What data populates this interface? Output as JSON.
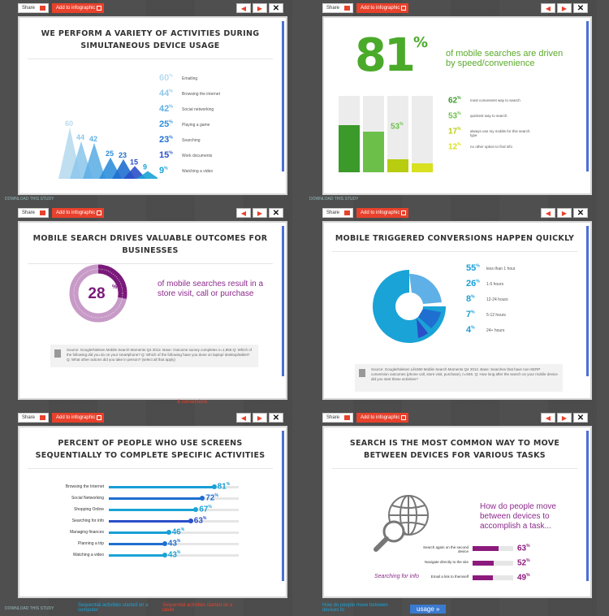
{
  "toolbar": {
    "share_label": "Share",
    "add_label": "Add to infographic",
    "prev": "◀",
    "next": "▶",
    "close": "✕"
  },
  "panel1": {
    "title": "WE PERFORM A VARIETY OF ACTIVITIES DURING SIMULTANEOUS DEVICE USAGE",
    "items": [
      {
        "pct": "60",
        "label": "Emailing"
      },
      {
        "pct": "44",
        "label": "Browsing the internet"
      },
      {
        "pct": "42",
        "label": "Social networking"
      },
      {
        "pct": "25",
        "label": "Playing a game"
      },
      {
        "pct": "23",
        "label": "Searching"
      },
      {
        "pct": "15",
        "label": "Work documents"
      },
      {
        "pct": "9",
        "label": "Watching a video"
      }
    ],
    "footer": "DOWNLOAD THIS STUDY",
    "colors": [
      "#b8dcf0",
      "#8fc8ec",
      "#5fb0e6",
      "#2f8fdc",
      "#1f6fd0",
      "#2a4fc8",
      "#1aa3d6"
    ]
  },
  "panel2": {
    "big_number": "81",
    "big_label": "of mobile searches are driven by speed/convenience",
    "items": [
      {
        "pct": "62",
        "label": "most convenient way to search",
        "color": "#3b9a2a"
      },
      {
        "pct": "53",
        "label": "quickest way to search",
        "color": "#6cc04a"
      },
      {
        "pct": "17",
        "label": "always use my mobile for this search type",
        "color": "#b8cc10"
      },
      {
        "pct": "12",
        "label": "no other option to find info",
        "color": "#d8e020"
      }
    ],
    "bar_label": "53",
    "footer": "DOWNLOAD THIS STUDY"
  },
  "panel3": {
    "title": "MOBILE SEARCH DRIVES VALUABLE OUTCOMES FOR BUSINESSES",
    "big_number": "28",
    "big_label": "of mobile searches result in a store visit, call or purchase",
    "value": 0.28,
    "source": "Source: Google/Nielsen Mobile Search Moments Q4 2012. Base: Outcome survey completes n=1,956 Q: Which of the following did you do on your smartphone? Q: Which of the following have you done on laptop/ desktop/tablet? Q: What other actions did you take in person? (select all that apply)",
    "below": "& conversions"
  },
  "panel4": {
    "title": "MOBILE TRIGGERED CONVERSIONS HAPPEN QUICKLY",
    "items": [
      {
        "pct": "55",
        "label": "less than 1 hour"
      },
      {
        "pct": "26",
        "label": "1-5 hours"
      },
      {
        "pct": "8",
        "label": "12-24 hours"
      },
      {
        "pct": "7",
        "label": "5-12 hours"
      },
      {
        "pct": "4",
        "label": "24+ hours"
      }
    ],
    "source": "Source: Google/Nielsen Life360 Mobile Search Moments Q4 2012. Base: Searches that have non-SERP conversion outcomes (phone call, store visit, purchase), n=506. Q: How long after the search on your mobile device did you start these activities?"
  },
  "panel5": {
    "title": "PERCENT OF PEOPLE WHO USE SCREENS SEQUENTIALLY TO COMPLETE SPECIFIC ACTIVITIES",
    "items": [
      {
        "label": "Browsing the Internet",
        "pct": "81",
        "value": 81
      },
      {
        "label": "Social Networking",
        "pct": "72",
        "value": 72
      },
      {
        "label": "Shopping Online",
        "pct": "67",
        "value": 67
      },
      {
        "label": "Searching for info",
        "pct": "63",
        "value": 63
      },
      {
        "label": "Managing finances",
        "pct": "46",
        "value": 46
      },
      {
        "label": "Planning a trip",
        "pct": "43",
        "value": 43
      },
      {
        "label": "Watching a video",
        "pct": "43",
        "value": 43
      }
    ],
    "colors": [
      "#1a9fd6",
      "#1f6fd0",
      "#1aa3d6",
      "#2a4fc8",
      "#1a9fd6",
      "#1f6fd0",
      "#1aa3d6"
    ],
    "footer": "DOWNLOAD THIS STUDY",
    "below1": "Sequential activities started on a computer",
    "below2": "Sequential activities started on a tablet"
  },
  "panel6": {
    "title": "SEARCH IS THE MOST COMMON WAY TO MOVE BETWEEN DEVICES FOR VARIOUS TASKS",
    "question": "How do people move between devices to accomplish a task...",
    "caption": "Searching for info",
    "items": [
      {
        "label": "Search again on the second device",
        "pct": "63",
        "value": 63
      },
      {
        "label": "Navigate directly to the site",
        "pct": "52",
        "value": 52
      },
      {
        "label": "Email a link to themself",
        "pct": "49",
        "value": 49
      }
    ],
    "below1": "How do people move between devices to",
    "below2": "usage »"
  }
}
